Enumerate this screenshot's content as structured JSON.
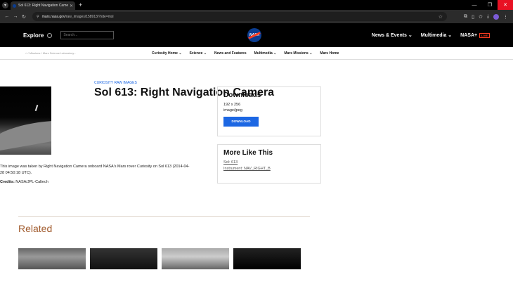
{
  "browser": {
    "tab_title": "Sol 613: Right Navigation Came",
    "url_host": "mars.nasa.gov",
    "url_path": "/raw_images/158913/?site=msl"
  },
  "header": {
    "explore_label": "Explore",
    "search_placeholder": "Search...",
    "logo_text": "NASA",
    "nav": {
      "news": "News & Events",
      "multimedia": "Multimedia",
      "nasaplus": "NASA+",
      "live": "LIVE"
    }
  },
  "breadcrumb": {
    "sep1": "/",
    "missions": "Missions",
    "sep2": "/",
    "msl": "Mars Science Laboratory..."
  },
  "subnav": [
    "Curiosity Home",
    "Science",
    "News and Features",
    "Multimedia",
    "Mars Missions",
    "Mars Home"
  ],
  "page": {
    "kicker": "CURIOSITY RAW IMAGES",
    "title": "Sol 613: Right Navigation Camera",
    "description": "This image was taken by Right Navigation Camera onboard NASA's Mars rover Curiosity on Sol 613 (2014-04-28 04:50:18 UTC).",
    "credits_label": "Credits:",
    "credits_value": " NASA/JPL-Caltech"
  },
  "downloads": {
    "heading": "Downloads",
    "dimensions": "192 x 256",
    "format": "image/jpeg",
    "button": "DOWNLOAD"
  },
  "more_like_this": {
    "heading": "More Like This",
    "sol_link": "Sol: 613",
    "instrument_link": "Instrument: NAV_RIGHT_B"
  },
  "related": {
    "heading": "Related"
  }
}
